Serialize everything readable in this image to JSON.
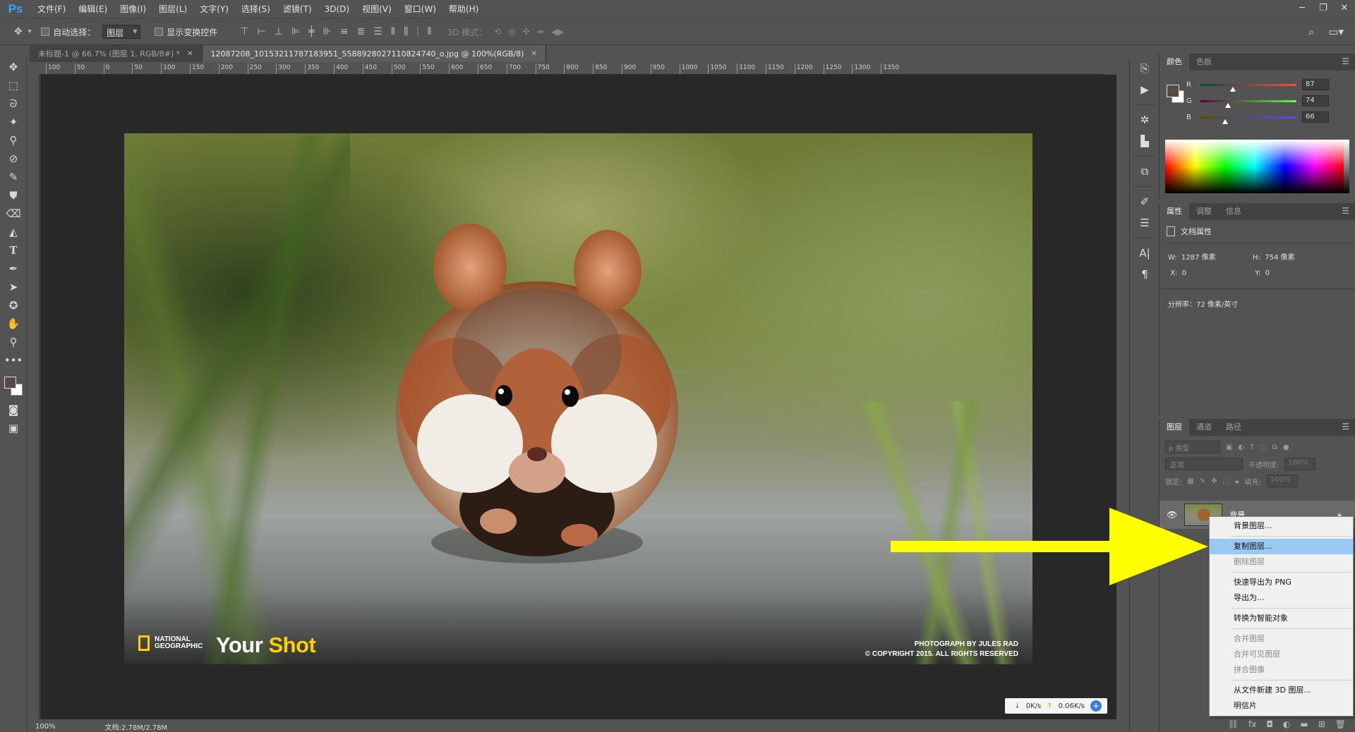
{
  "app": {
    "logo": "Ps"
  },
  "menubar": {
    "items": [
      "文件(F)",
      "编辑(E)",
      "图像(I)",
      "图层(L)",
      "文字(Y)",
      "选择(S)",
      "滤镜(T)",
      "3D(D)",
      "视图(V)",
      "窗口(W)",
      "帮助(H)"
    ],
    "window_controls": [
      "minimize-icon",
      "restore-icon",
      "close-icon"
    ]
  },
  "options": {
    "auto_select_label": "自动选择：",
    "auto_select_value": "图层",
    "show_transform_label": "显示变换控件",
    "mode_3d_label": "3D 模式："
  },
  "tabs": [
    {
      "title": "未标题-1 @ 66.7% (图层 1, RGB/8#) *",
      "active": false
    },
    {
      "title": "12087208_10153211787183951_5588928027110824740_o.jpg @ 100%(RGB/8)",
      "active": true
    }
  ],
  "ruler": {
    "ticks": [
      "100",
      "50",
      "0",
      "50",
      "100",
      "150",
      "200",
      "250",
      "300",
      "350",
      "400",
      "450",
      "500",
      "550",
      "600",
      "650",
      "700",
      "750",
      "800",
      "850",
      "900",
      "950",
      "1000",
      "1050",
      "1100",
      "1150",
      "1200",
      "1250",
      "1300",
      "1350"
    ]
  },
  "status": {
    "zoom": "100%",
    "doc_size": "文档:2.78M/2.78M"
  },
  "photo": {
    "ng_line1": "NATIONAL",
    "ng_line2": "GEOGRAPHIC",
    "your": "Your",
    "shot": "Shot",
    "credit_line1": "PHOTOGRAPH BY JULES RAD",
    "credit_line2": "© COPYRIGHT 2015. ALL RIGHTS RESERVED"
  },
  "netspeed": {
    "down": "0K/s",
    "up": "0.06K/s"
  },
  "color_panel": {
    "tabs": [
      "颜色",
      "色板"
    ],
    "foreground": "#574a42",
    "channels": [
      {
        "label": "R",
        "value": "87",
        "fraction": 0.341
      },
      {
        "label": "G",
        "value": "74",
        "fraction": 0.29
      },
      {
        "label": "B",
        "value": "66",
        "fraction": 0.259
      }
    ]
  },
  "properties_panel": {
    "tabs": [
      "属性",
      "调整",
      "信息"
    ],
    "heading": "文档属性",
    "w_label": "W:",
    "w_value": "1287 像素",
    "h_label": "H:",
    "h_value": "754 像素",
    "x_label": "X:",
    "x_value": "0",
    "y_label": "Y:",
    "y_value": "0",
    "resolution": "分辨率：72 像素/英寸"
  },
  "layers_panel": {
    "tabs": [
      "图层",
      "通道",
      "路径"
    ],
    "search_placeholder": "ρ 类型",
    "blend_mode": "正常",
    "opacity_label": "不透明度:",
    "opacity_value": "100%",
    "lock_label": "锁定:",
    "fill_label": "填充:",
    "fill_value": "100%",
    "layer_name": "背景"
  },
  "context_menu": {
    "items": [
      {
        "label": "背景图层...",
        "state": "normal"
      },
      {
        "sep": true
      },
      {
        "label": "复制图层...",
        "state": "selected"
      },
      {
        "label": "删除图层",
        "state": "disabled"
      },
      {
        "sep": true
      },
      {
        "label": "快速导出为 PNG",
        "state": "normal"
      },
      {
        "label": "导出为...",
        "state": "normal"
      },
      {
        "sep": true
      },
      {
        "label": "转换为智能对象",
        "state": "normal"
      },
      {
        "sep": true
      },
      {
        "label": "合并图层",
        "state": "disabled"
      },
      {
        "label": "合并可见图层",
        "state": "disabled"
      },
      {
        "label": "拼合图像",
        "state": "disabled"
      },
      {
        "sep": true
      },
      {
        "label": "从文件新建 3D 图层...",
        "state": "normal"
      },
      {
        "label": "明信片",
        "state": "normal"
      }
    ]
  },
  "annotation": {
    "arrow_color": "#ffff00"
  }
}
